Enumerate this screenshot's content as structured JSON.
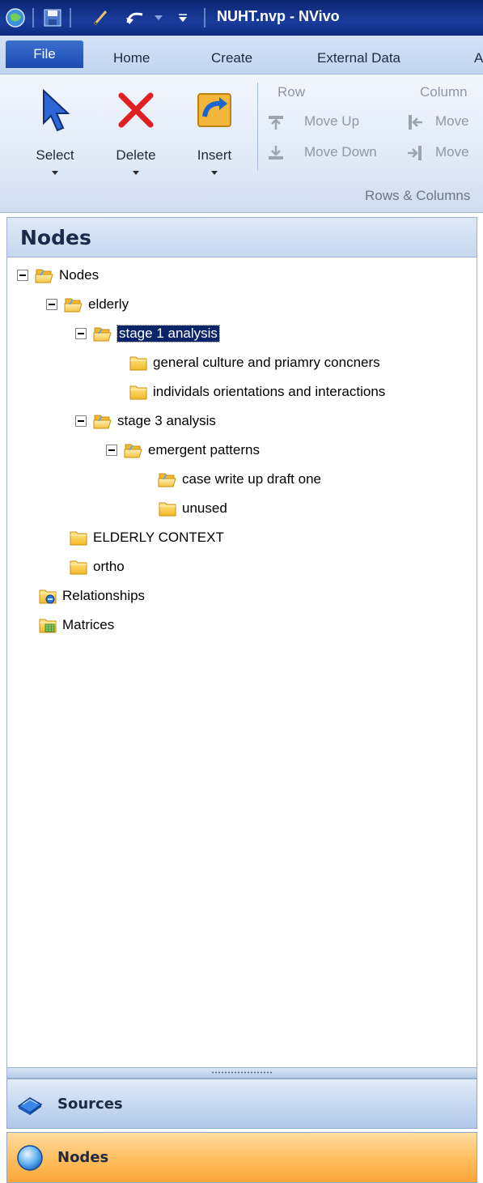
{
  "window": {
    "title": "NUHT.nvp - NVivo"
  },
  "tabs": [
    "File",
    "Home",
    "Create",
    "External Data",
    "A"
  ],
  "ribbon": {
    "select_label": "Select",
    "delete_label": "Delete",
    "insert_label": "Insert",
    "row_label": "Row",
    "column_label": "Column",
    "move_up_label": "Move Up",
    "move_down_label": "Move Down",
    "move_left_label": "Move",
    "move_right_label": "Move",
    "group_label": "Rows & Columns"
  },
  "panel": {
    "title": "Nodes"
  },
  "tree": {
    "root": "Nodes",
    "elderly": "elderly",
    "stage1": "stage 1 analysis",
    "general": "general culture and priamry concners",
    "individuals": "individals orientations and interactions",
    "stage3": "stage 3 analysis",
    "emergent": "emergent patterns",
    "case": "case write up draft one",
    "unused": "unused",
    "elderly_context": "ELDERLY CONTEXT",
    "ortho": "ortho",
    "relationships": "Relationships",
    "matrices": "Matrices"
  },
  "nav": {
    "sources": "Sources",
    "nodes": "Nodes"
  },
  "colors": {
    "titlebar": "#1a3c9c",
    "selection": "#0a246a",
    "active_nav": "#ffbd5c"
  }
}
